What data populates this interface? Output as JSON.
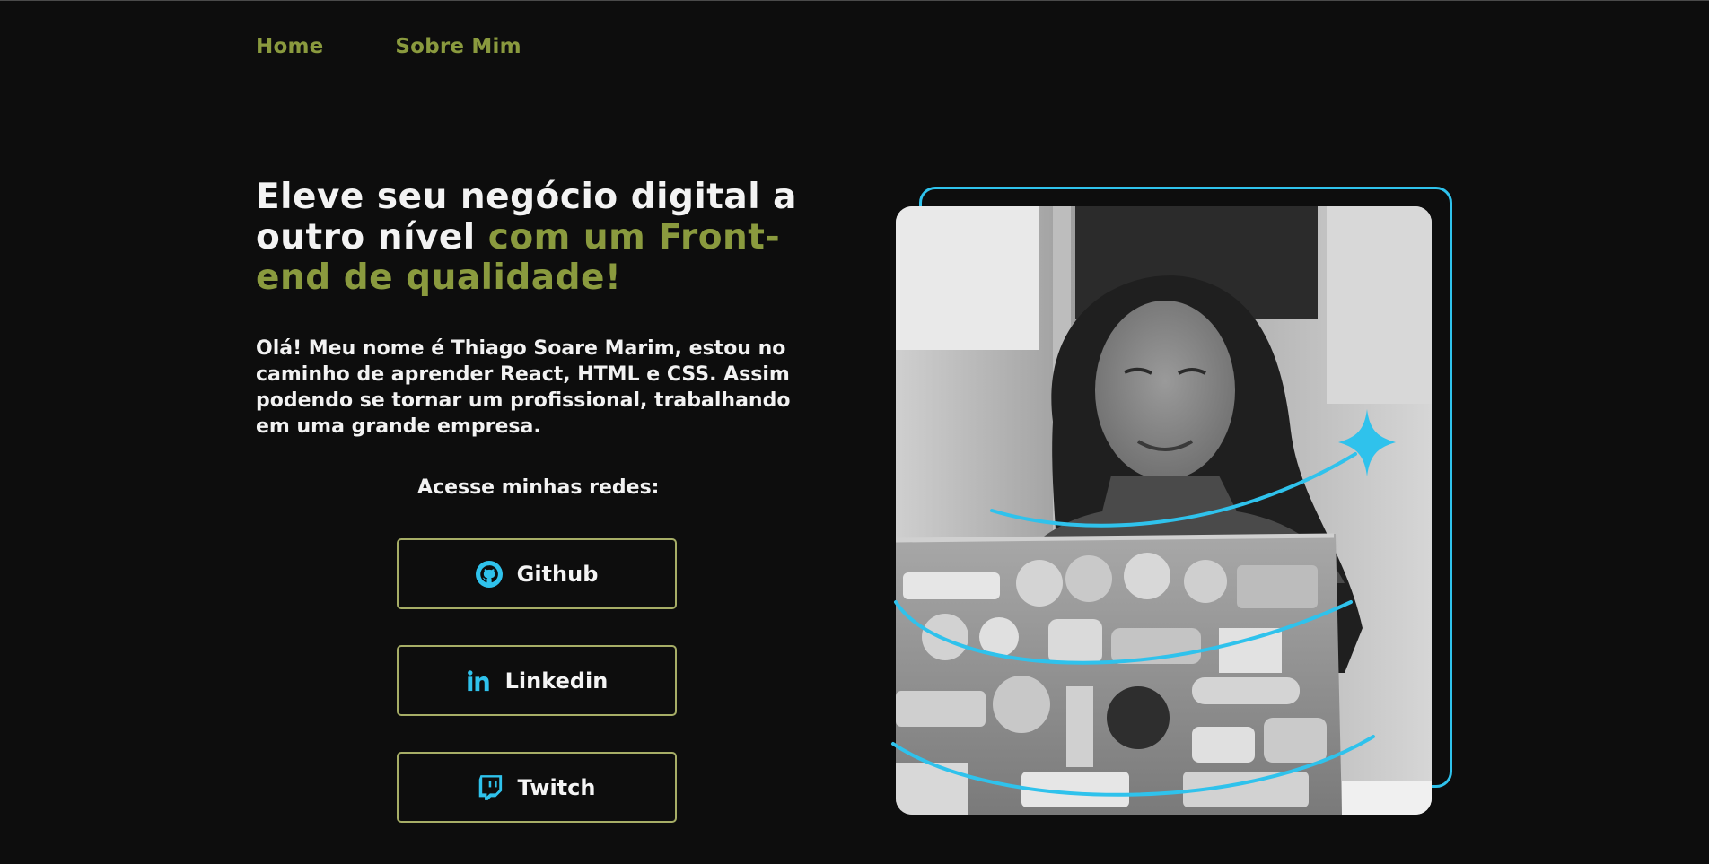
{
  "nav": {
    "items": [
      {
        "label": "Home"
      },
      {
        "label": "Sobre Mim"
      }
    ]
  },
  "hero": {
    "headline_white": "Eleve seu negócio digital a outro nível",
    "headline_accent": "com um Front-end de qualidade!",
    "intro": "Olá! Meu nome é Thiago Soare Marim, estou no caminho de aprender React, HTML e CSS. Assim podendo se tornar um profissional, trabalhando em uma grande empresa."
  },
  "networks": {
    "title": "Acesse minhas redes:",
    "buttons": [
      {
        "label": "Github",
        "icon": "github-icon"
      },
      {
        "label": "Linkedin",
        "icon": "linkedin-icon"
      },
      {
        "label": "Twitch",
        "icon": "twitch-icon"
      }
    ]
  },
  "photo": {
    "alt_subject": "woman smiling at laptop with stickers"
  },
  "colors": {
    "background": "#0d0d0d",
    "accent_green": "#8a9a3e",
    "button_border": "#a6ad66",
    "accent_cyan": "#2fc2ec",
    "text": "#f2f2f2"
  }
}
